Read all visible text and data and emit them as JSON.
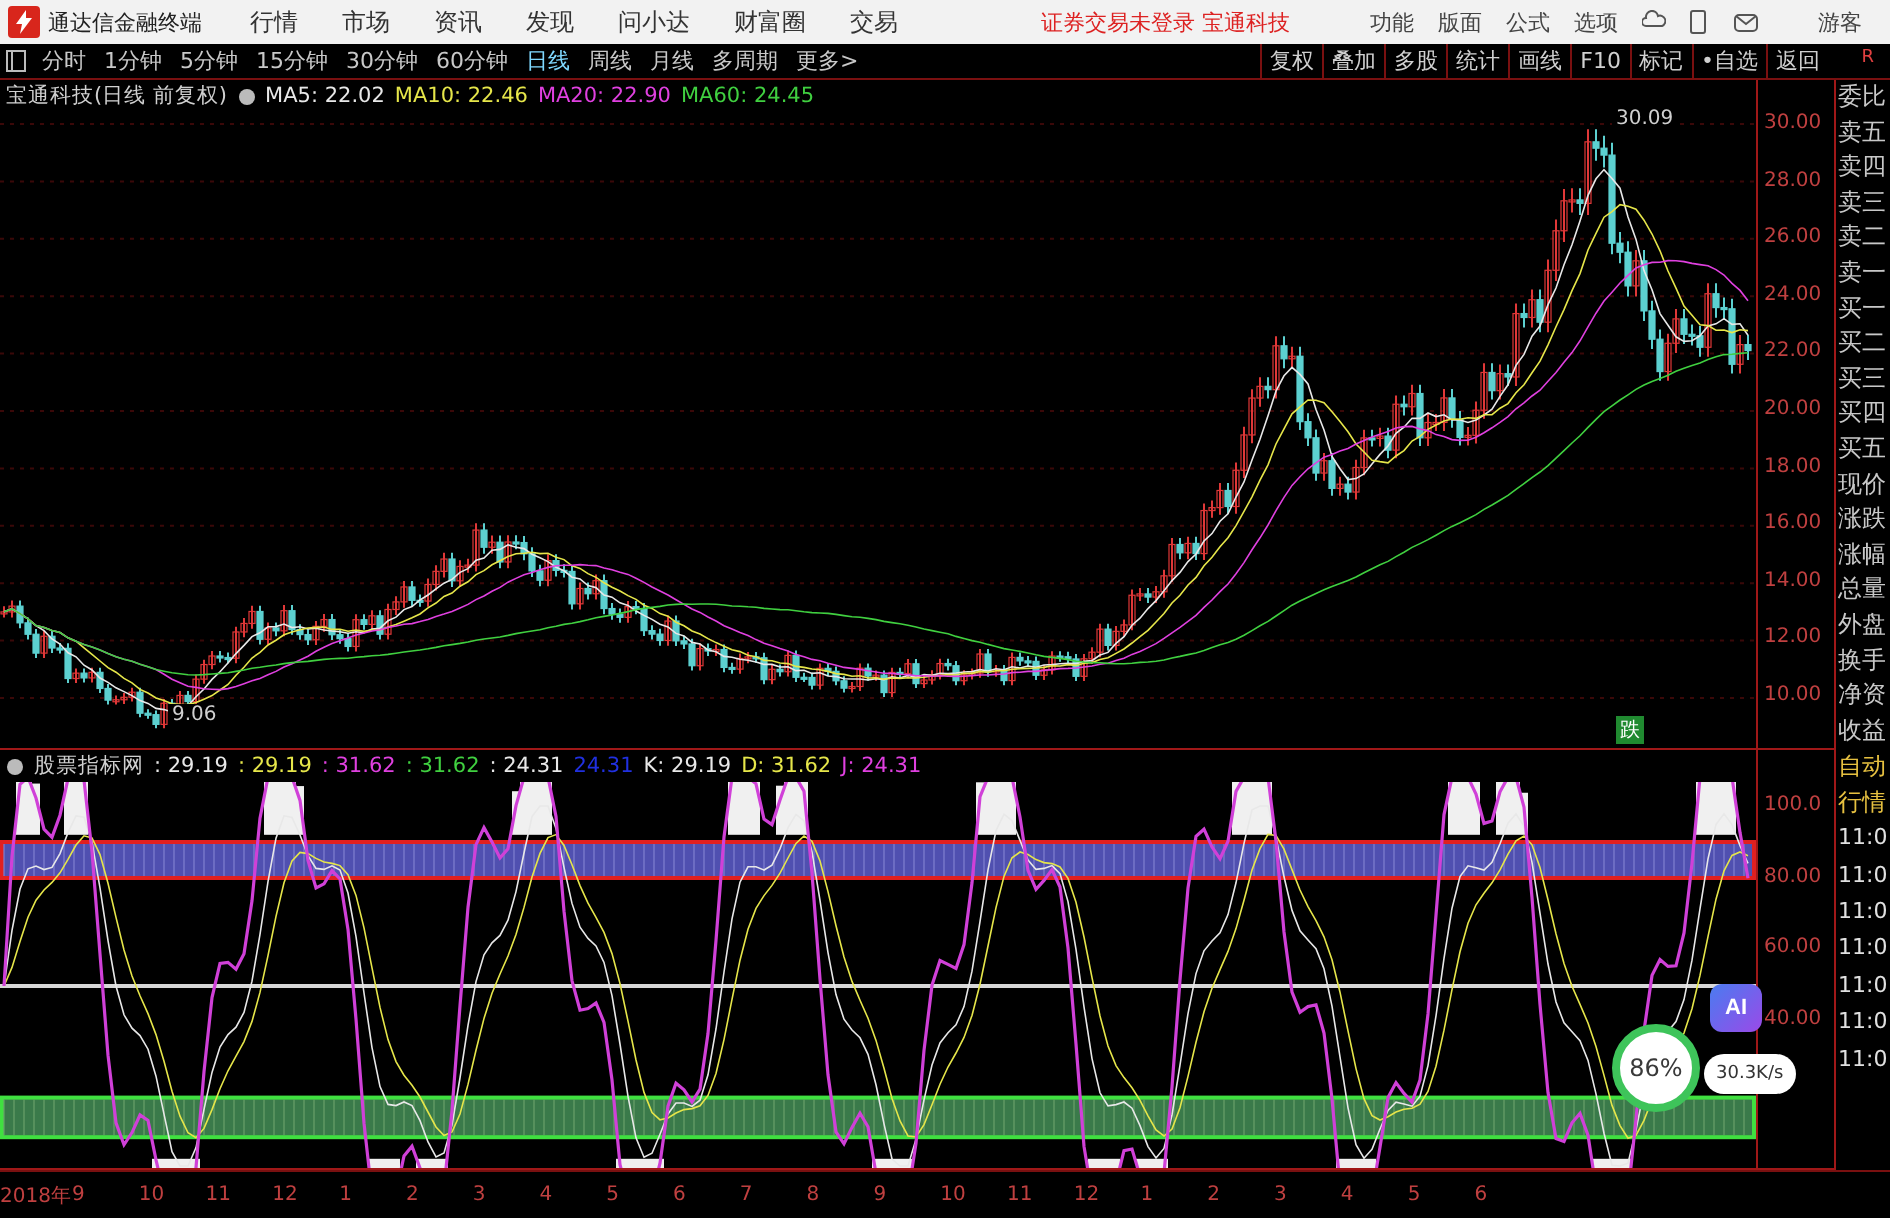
{
  "app_bar": {
    "title": "通达信金融终端",
    "menu": [
      "行情",
      "市场",
      "资讯",
      "发现",
      "问小达",
      "财富圈",
      "交易"
    ],
    "notice": "证券交易未登录 宝通科技",
    "right_menu": [
      "功能",
      "版面",
      "公式",
      "选项"
    ],
    "user": "游客"
  },
  "period_tabs": [
    {
      "label": "分时",
      "selected": false
    },
    {
      "label": "1分钟",
      "selected": false
    },
    {
      "label": "5分钟",
      "selected": false
    },
    {
      "label": "15分钟",
      "selected": false
    },
    {
      "label": "30分钟",
      "selected": false
    },
    {
      "label": "60分钟",
      "selected": false
    },
    {
      "label": "日线",
      "selected": true
    },
    {
      "label": "周线",
      "selected": false
    },
    {
      "label": "月线",
      "selected": false
    },
    {
      "label": "多周期",
      "selected": false
    },
    {
      "label": "更多>",
      "selected": false
    }
  ],
  "tools": [
    "复权",
    "叠加",
    "多股",
    "统计",
    "画线",
    "F10",
    "标记",
    "•自选",
    "返回"
  ],
  "price_chart": {
    "legend": "宝通科技(日线 前复权)",
    "ma": [
      {
        "label": "MA5: 22.02",
        "color": "#e8e8e8"
      },
      {
        "label": "MA10: 22.46",
        "color": "#e6e64a"
      },
      {
        "label": "MA20: 22.90",
        "color": "#e040e0"
      },
      {
        "label": "MA60: 24.45",
        "color": "#40d040"
      }
    ],
    "high_label": "30.09",
    "low_label": "9.06",
    "signal_tag": "跌",
    "yticks": [
      "30.00",
      "28.00",
      "26.00",
      "24.00",
      "22.00",
      "20.00",
      "18.00",
      "16.00",
      "14.00",
      "12.00",
      "10.00"
    ]
  },
  "indicator": {
    "name": "股票指标网",
    "values": [
      {
        "label": ": 29.19",
        "color": "#e8e8e8"
      },
      {
        "label": ": 29.19",
        "color": "#e6e64a"
      },
      {
        "label": ": 31.62",
        "color": "#e040e0"
      },
      {
        "label": ": 31.62",
        "color": "#40d040"
      },
      {
        "label": ": 24.31",
        "color": "#e8e8e8"
      },
      {
        "label": "24.31",
        "color": "#2030e0"
      },
      {
        "label": "K: 29.19",
        "color": "#e8e8e8"
      },
      {
        "label": "D: 31.62",
        "color": "#e6e64a"
      },
      {
        "label": "J: 24.31",
        "color": "#e040e0"
      }
    ],
    "yticks": [
      "100.0",
      "80.00",
      "60.00",
      "40.00"
    ]
  },
  "dates": [
    "2018年",
    "9",
    "10",
    "11",
    "12",
    "1",
    "2",
    "3",
    "4",
    "5",
    "6",
    "7",
    "8",
    "9",
    "10",
    "11",
    "12",
    "1",
    "2",
    "3",
    "4",
    "5",
    "6"
  ],
  "side_panel": {
    "corner": "R",
    "quote_labels": [
      "委比",
      "卖五",
      "卖四",
      "卖三",
      "卖二",
      "卖一",
      "买一",
      "买二",
      "买三",
      "买四",
      "买五",
      "现价",
      "涨跌",
      "涨幅",
      "总量",
      "外盘",
      "换手",
      "净资",
      "收益"
    ],
    "tick_header": [
      "自动",
      "行情"
    ],
    "tick_times": [
      "11:0",
      "11:0",
      "11:0",
      "11:0",
      "11:0",
      "11:0",
      "11:0"
    ]
  },
  "widget": {
    "ai": "AI",
    "percent": "86%",
    "speed": "30.3K/s"
  }
}
